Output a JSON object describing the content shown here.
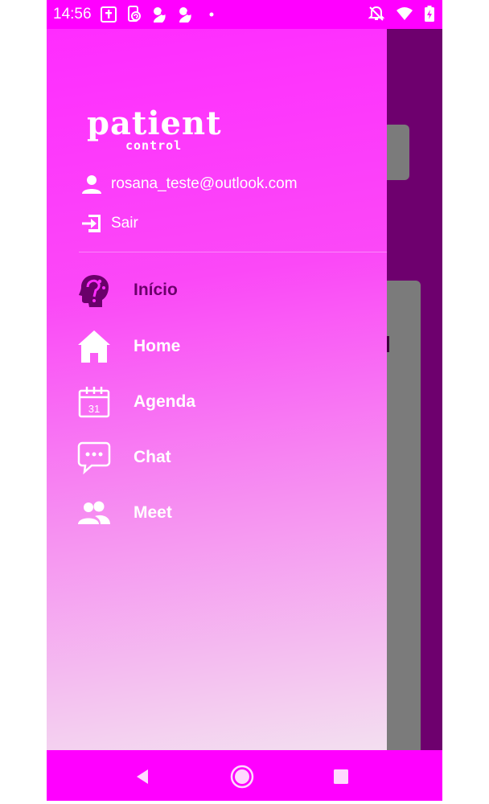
{
  "status_bar": {
    "time": "14:56",
    "left_icons": [
      "bible-icon",
      "phone-sync-icon",
      "app-icon",
      "app-icon",
      "dot-icon"
    ],
    "right_icons": [
      "mute-notifications-icon",
      "wifi-icon",
      "battery-icon"
    ]
  },
  "drawer": {
    "logo": {
      "main": "patient",
      "sub": "control"
    },
    "user_email": "rosana_teste@outlook.com",
    "logout_label": "Sair",
    "menu": [
      {
        "label": "Início",
        "icon": "brain-head-icon"
      },
      {
        "label": "Home",
        "icon": "house-icon"
      },
      {
        "label": "Agenda",
        "icon": "calendar-icon",
        "calendar_day": "31"
      },
      {
        "label": "Chat",
        "icon": "chat-bubble-icon"
      },
      {
        "label": "Meet",
        "icon": "group-people-icon"
      }
    ]
  },
  "nav_bar": {
    "buttons": [
      "back",
      "home",
      "recents"
    ]
  },
  "colors": {
    "status_bar": "#ff00ff",
    "drawer_top": "#ff2cff",
    "drawer_bottom": "#f3dff0",
    "background_app": "#6e006e",
    "active_item_text": "#6a006a"
  }
}
